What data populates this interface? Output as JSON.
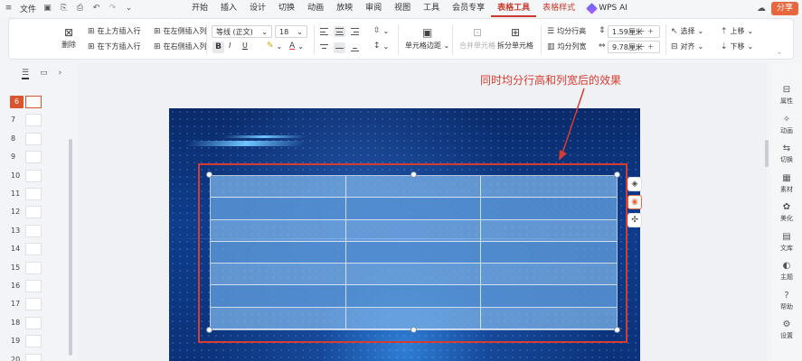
{
  "menubar": {
    "app_menu": "文件",
    "quick_icons": [
      "save-icon",
      "export-icon",
      "print-icon",
      "undo-icon",
      "redo-icon"
    ],
    "tabs": [
      {
        "label": "开始",
        "state": "normal"
      },
      {
        "label": "插入",
        "state": "normal"
      },
      {
        "label": "设计",
        "state": "normal"
      },
      {
        "label": "切换",
        "state": "normal"
      },
      {
        "label": "动画",
        "state": "normal"
      },
      {
        "label": "放映",
        "state": "normal"
      },
      {
        "label": "审阅",
        "state": "normal"
      },
      {
        "label": "视图",
        "state": "normal"
      },
      {
        "label": "工具",
        "state": "normal"
      },
      {
        "label": "会员专享",
        "state": "normal"
      },
      {
        "label": "表格工具",
        "state": "active"
      },
      {
        "label": "表格样式",
        "state": "accent"
      }
    ],
    "wps_ai": "WPS AI",
    "share_label": "分享"
  },
  "ribbon": {
    "delete_label": "删除",
    "insert_above": "在上方插入行",
    "insert_left": "在左侧插入列",
    "insert_below": "在下方插入行",
    "insert_right": "在右侧插入列",
    "font_name": "等线 (正文)",
    "font_size": "18",
    "bold": "B",
    "italic": "I",
    "underline": "U",
    "cell_margin": "单元格边距",
    "merge_cells": "合并单元格",
    "split_cells": "拆分单元格",
    "distribute_rows": "均分行高",
    "distribute_cols": "均分列宽",
    "row_height": "1.59厘米",
    "col_width": "9.78厘米",
    "select_label": "选择",
    "align_label": "对齐",
    "bring_up": "上移",
    "send_down": "下移"
  },
  "slides_panel": {
    "current": "6",
    "numbers": [
      "6",
      "7",
      "8",
      "9",
      "10",
      "11",
      "12",
      "13",
      "14",
      "15",
      "16",
      "17",
      "18",
      "19",
      "20"
    ]
  },
  "annotation": {
    "text": "同时均分行高和列宽后的效果",
    "color": "#d83b2f"
  },
  "table": {
    "rows": 7,
    "cols": 3
  },
  "right_panel": {
    "items": [
      {
        "label": "属性",
        "icon": "properties-icon"
      },
      {
        "label": "动画",
        "icon": "animation-icon"
      },
      {
        "label": "切换",
        "icon": "transition-icon"
      },
      {
        "label": "素材",
        "icon": "assets-icon"
      },
      {
        "label": "美化",
        "icon": "beautify-icon"
      },
      {
        "label": "文库",
        "icon": "library-icon"
      },
      {
        "label": "主题",
        "icon": "theme-icon"
      },
      {
        "label": "帮助",
        "icon": "help-icon"
      },
      {
        "label": "设置",
        "icon": "settings-icon"
      }
    ]
  },
  "colors": {
    "accent": "#c7392a",
    "share": "#e8673f",
    "current_slide": "#d9552f"
  }
}
